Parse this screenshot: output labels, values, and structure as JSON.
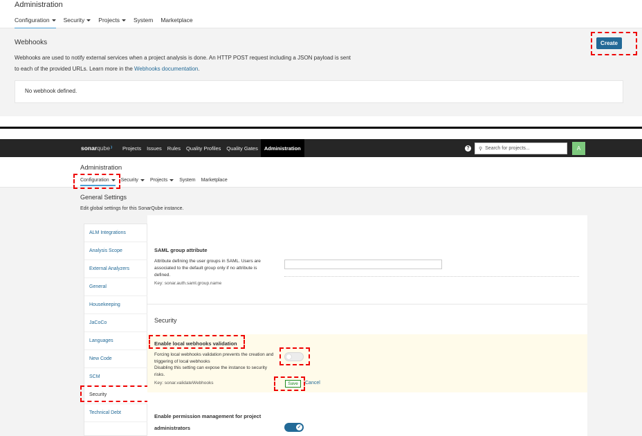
{
  "top": {
    "title": "Administration",
    "nav": [
      {
        "label": "Configuration",
        "dropdown": true
      },
      {
        "label": "Security",
        "dropdown": true
      },
      {
        "label": "Projects",
        "dropdown": true
      },
      {
        "label": "System",
        "dropdown": false
      },
      {
        "label": "Marketplace",
        "dropdown": false
      }
    ],
    "webhooks": {
      "title": "Webhooks",
      "desc_line1": "Webhooks are used to notify external services when a project analysis is done. An HTTP POST request including a JSON payload is sent",
      "desc_line2": "to each of the provided URLs. Learn more in the ",
      "link": "Webhooks documentation",
      "desc_end": ".",
      "create_label": "Create",
      "empty_text": "No webhook defined."
    }
  },
  "bottom": {
    "navbar": {
      "logo_bold": "sonar",
      "logo_light": "qube",
      "menu": [
        "Projects",
        "Issues",
        "Rules",
        "Quality Profiles",
        "Quality Gates",
        "Administration"
      ],
      "help_glyph": "?",
      "search_placeholder": "Search for projects...",
      "search_icon": "search-icon",
      "avatar": "A"
    },
    "admin": {
      "title": "Administration",
      "nav": [
        {
          "label": "Configuration",
          "dropdown": true
        },
        {
          "label": "Security",
          "dropdown": true
        },
        {
          "label": "Projects",
          "dropdown": true
        },
        {
          "label": "System",
          "dropdown": false
        },
        {
          "label": "Marketplace",
          "dropdown": false
        }
      ]
    },
    "general_settings": {
      "title": "General Settings",
      "desc": "Edit global settings for this SonarQube instance."
    },
    "sidebar": [
      "ALM Integrations",
      "Analysis Scope",
      "External Analyzers",
      "General",
      "Housekeeping",
      "JaCoCo",
      "Languages",
      "New Code",
      "SCM",
      "Security",
      "Technical Debt"
    ],
    "saml": {
      "title": "SAML group attribute",
      "desc": "Attribute defining the user groups in SAML. Users are associated to the default group only if no attribute is defined.",
      "key": "Key: sonar.auth.saml.group.name"
    },
    "security_heading": "Security",
    "webhook_validation": {
      "title": "Enable local webhooks validation",
      "desc1": "Forcing local webhooks validation prevents the creation and triggering of local webhooks",
      "desc2": "Disabling this setting can expose the instance to security risks.",
      "key": "Key: sonar.validateWebhooks",
      "save": "Save",
      "cancel": "Cancel",
      "enabled": false
    },
    "permission": {
      "title": "Enable permission management for project administrators",
      "enabled": true,
      "check_glyph": "✓"
    }
  },
  "colors": {
    "accent": "#236a97",
    "highlight": "#ee0000",
    "save_green": "#1d8a1d"
  }
}
